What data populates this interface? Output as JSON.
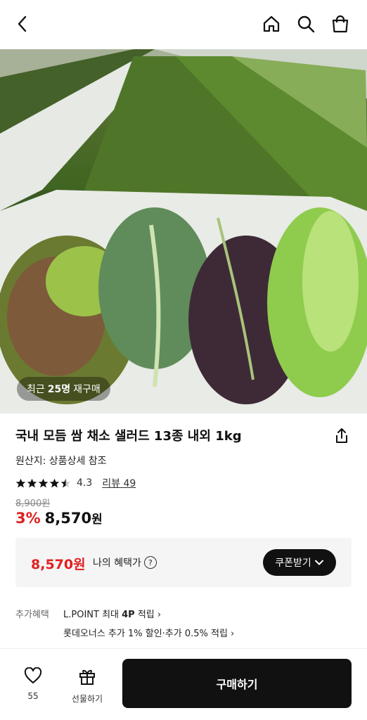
{
  "header": {
    "icons": [
      "chevron-left-icon",
      "home-icon",
      "search-icon",
      "shopping-bag-icon"
    ]
  },
  "product": {
    "rebuy_prefix": "최근",
    "rebuy_count": "25명",
    "rebuy_suffix": "재구매",
    "title": "국내 모듬 쌈 채소 샐러드 13종 내외 1kg",
    "origin": "원산지: 상품상세 참조",
    "rating": "4.3",
    "rating_value": 4.3,
    "review_label": "리뷰 49",
    "original_price": "8,900원",
    "discount": "3%",
    "price": "8,570",
    "price_unit": "원"
  },
  "benefit": {
    "price": "8,570원",
    "label": "나의 혜택가",
    "help_glyph": "?",
    "coupon_button": "쿠폰받기"
  },
  "extra": {
    "label": "추가혜택",
    "line1_prefix": "L.POINT 최대 ",
    "line1_bold": "4P",
    "line1_suffix": " 적립 ›",
    "line2": "롯데오너스 추가 1% 할인·추가 0.5% 적립 ›"
  },
  "bottom_bar": {
    "like_count": "55",
    "gift_label": "선물하기",
    "buy_label": "구매하기"
  },
  "colors": {
    "accent_red": "#e02020",
    "dark": "#111111"
  }
}
